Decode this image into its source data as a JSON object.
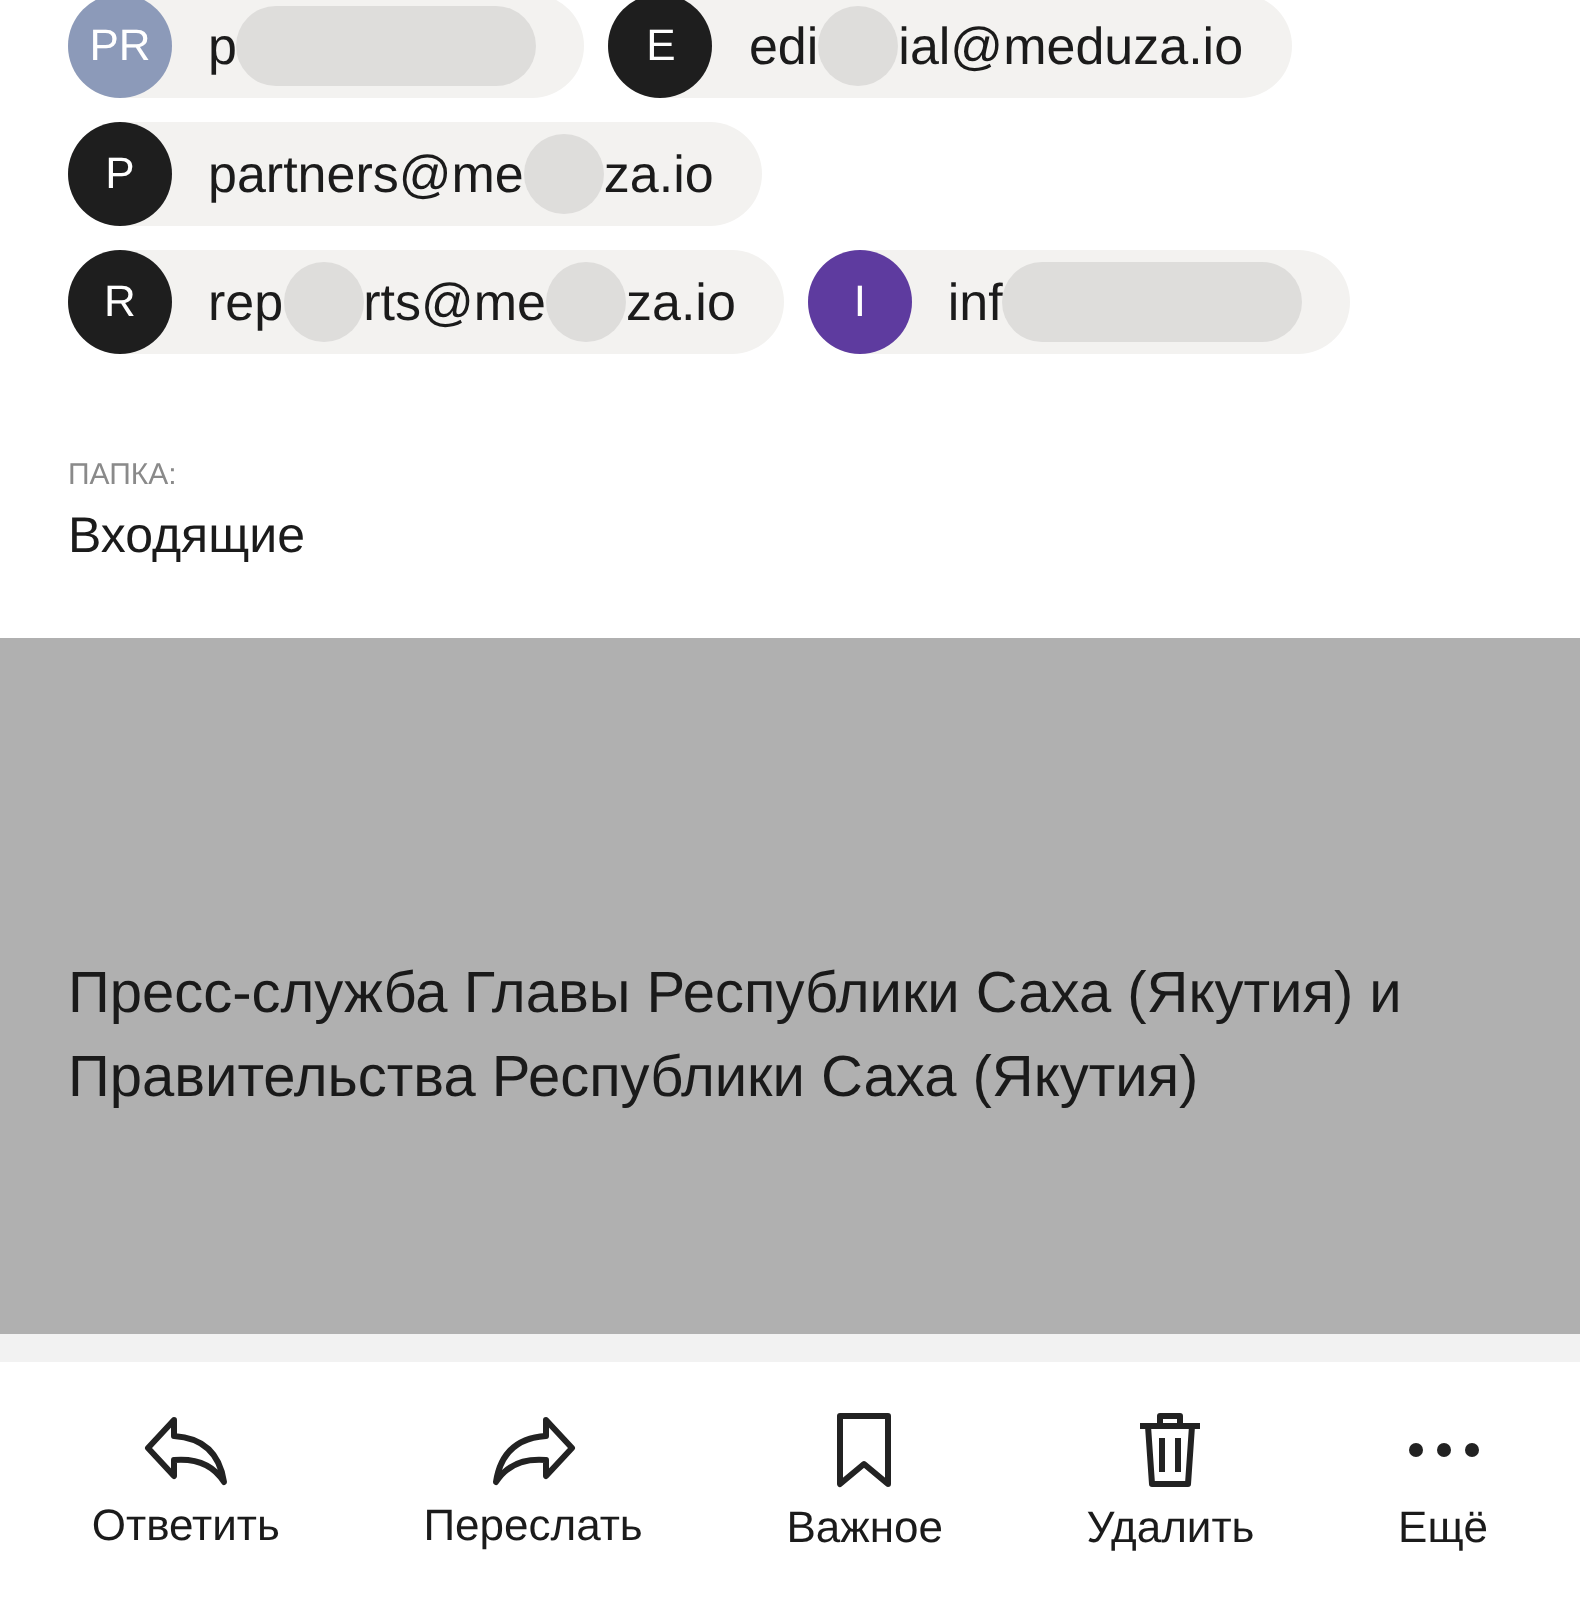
{
  "recipients": [
    {
      "initials": "PR",
      "color": "#8c9ab9",
      "parts": [
        "p"
      ],
      "trailing_blur": true
    },
    {
      "initials": "E",
      "color": "#1e1e1e",
      "parts": [
        "edi",
        "ial@meduza.io"
      ]
    },
    {
      "initials": "P",
      "color": "#1e1e1e",
      "parts": [
        "partners@me",
        "za.io"
      ]
    },
    {
      "initials": "R",
      "color": "#1e1e1e",
      "parts": [
        "rep",
        "rts@me",
        "za.io"
      ]
    },
    {
      "initials": "I",
      "color": "#5e3b9f",
      "parts": [
        "inf"
      ],
      "trailing_blur": true
    }
  ],
  "folder": {
    "label": "ПАПКА:",
    "value": "Входящие"
  },
  "message": {
    "text": "Пресс-служба Главы Республики Саха (Якутия) и Правительства Республики Саха (Якутия)"
  },
  "actions": [
    {
      "kind": "reply",
      "label": "Ответить"
    },
    {
      "kind": "forward",
      "label": "Переслать"
    },
    {
      "kind": "bookmark",
      "label": "Важное"
    },
    {
      "kind": "trash",
      "label": "Удалить"
    },
    {
      "kind": "more",
      "label": "Ещё"
    }
  ]
}
